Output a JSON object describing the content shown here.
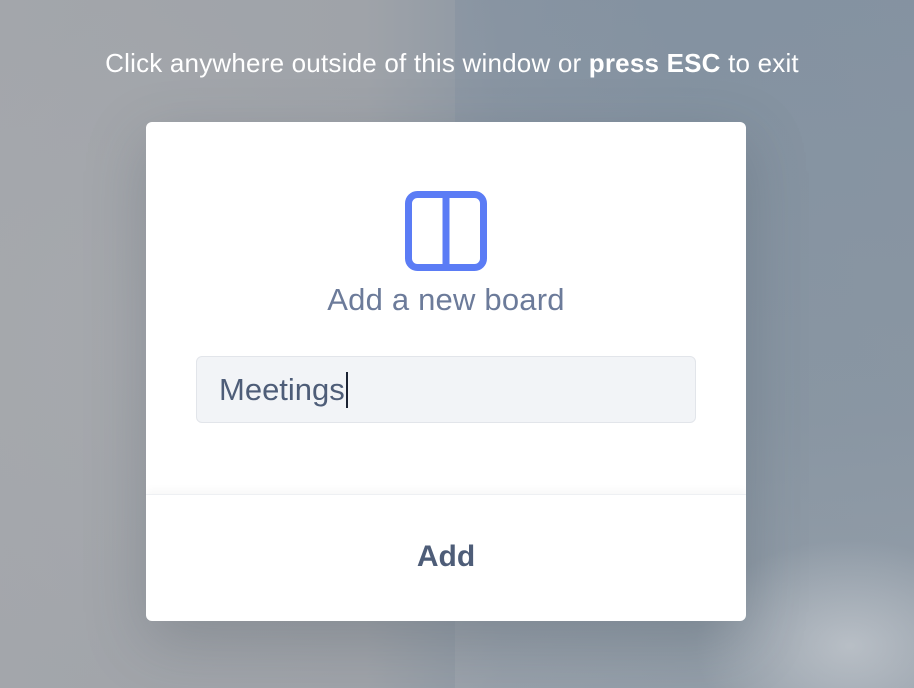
{
  "overlay": {
    "hint_prefix": "Click anywhere outside of this window or ",
    "hint_bold": "press ESC",
    "hint_suffix": " to exit"
  },
  "modal": {
    "icon": "board-columns-icon",
    "title": "Add a new board",
    "input_value": "Meetings",
    "submit_label": "Add"
  },
  "colors": {
    "accent": "#5b7cf5",
    "title_text": "#6c7b9a",
    "body_text": "#4e5d78",
    "input_bg": "#f2f4f7"
  }
}
